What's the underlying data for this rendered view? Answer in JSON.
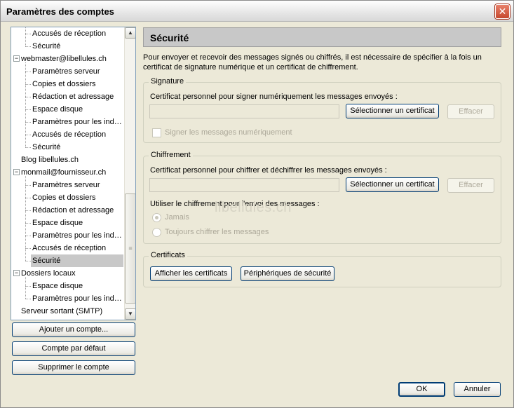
{
  "window": {
    "title": "Paramètres des comptes",
    "close_glyph": "✕"
  },
  "tree": {
    "items": [
      {
        "label": "Accusés de réception",
        "level": 2
      },
      {
        "label": "Sécurité",
        "level": 2
      },
      {
        "label": "webmaster@libellules.ch",
        "level": 1,
        "expanded": true
      },
      {
        "label": "Paramètres serveur",
        "level": 2
      },
      {
        "label": "Copies et dossiers",
        "level": 2
      },
      {
        "label": "Rédaction et adressage",
        "level": 2
      },
      {
        "label": "Espace disque",
        "level": 2
      },
      {
        "label": "Paramètres pour les ind…",
        "level": 2
      },
      {
        "label": "Accusés de réception",
        "level": 2
      },
      {
        "label": "Sécurité",
        "level": 2
      },
      {
        "label": "Blog libellules.ch",
        "level": 1
      },
      {
        "label": "monmail@fournisseur.ch",
        "level": 1,
        "expanded": true
      },
      {
        "label": "Paramètres serveur",
        "level": 2
      },
      {
        "label": "Copies et dossiers",
        "level": 2
      },
      {
        "label": "Rédaction et adressage",
        "level": 2
      },
      {
        "label": "Espace disque",
        "level": 2
      },
      {
        "label": "Paramètres pour les ind…",
        "level": 2
      },
      {
        "label": "Accusés de réception",
        "level": 2
      },
      {
        "label": "Sécurité",
        "level": 2,
        "selected": true
      },
      {
        "label": "Dossiers locaux",
        "level": 1,
        "expanded": true
      },
      {
        "label": "Espace disque",
        "level": 2
      },
      {
        "label": "Paramètres pour les ind…",
        "level": 2
      },
      {
        "label": "Serveur sortant (SMTP)",
        "level": 1
      }
    ],
    "scroll_up_glyph": "▲",
    "scroll_down_glyph": "▼",
    "scroll_grip_glyph": "≡"
  },
  "left_buttons": {
    "add_account": "Ajouter un compte...",
    "default_account": "Compte par défaut",
    "delete_account": "Supprimer le compte"
  },
  "panel": {
    "title": "Sécurité",
    "intro": "Pour envoyer et recevoir des messages signés ou chiffrés, il est nécessaire de spécifier à la fois un certificat de signature numérique et un certificat de chiffrement.",
    "signature": {
      "group_label": "Signature",
      "cert_label": "Certificat personnel pour signer numériquement les messages envoyés :",
      "select_button": "Sélectionner un certificat",
      "clear_button": "Effacer",
      "sign_checkbox": "Signer les messages numériquement"
    },
    "encryption": {
      "group_label": "Chiffrement",
      "cert_label": "Certificat personnel pour chiffrer et déchiffrer les messages envoyés :",
      "select_button": "Sélectionner un certificat",
      "clear_button": "Effacer",
      "policy_label": "Utiliser le chiffrement pour l'envoi des messages :",
      "never": "Jamais",
      "always": "Toujours chiffrer les messages"
    },
    "certificates": {
      "group_label": "Certificats",
      "view_button": "Afficher les certificats",
      "devices_button": "Périphériques de sécurité"
    },
    "watermark": "libellules.ch"
  },
  "footer": {
    "ok": "OK",
    "cancel": "Annuler"
  }
}
